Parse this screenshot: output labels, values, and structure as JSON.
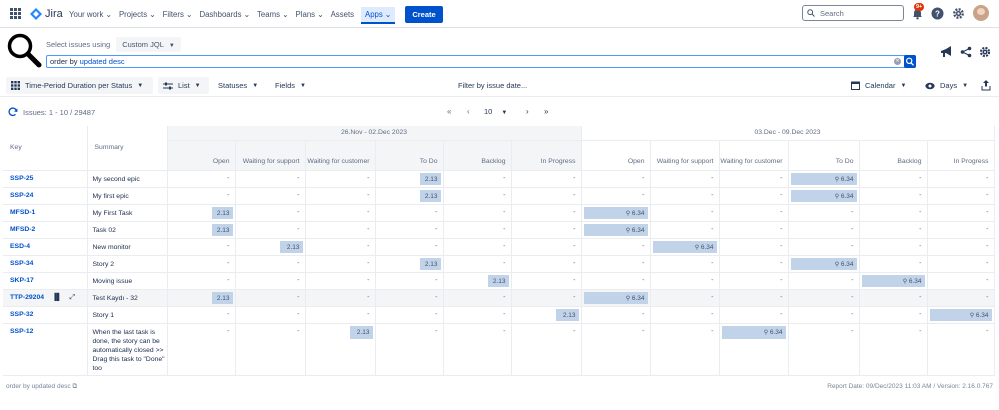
{
  "topnav": {
    "app_name": "Jira",
    "items": [
      "Your work",
      "Projects",
      "Filters",
      "Dashboards",
      "Teams",
      "Plans",
      "Assets",
      "Apps"
    ],
    "active_index": 7,
    "create_label": "Create",
    "search_placeholder": "Search",
    "notif_badge": "9+"
  },
  "filter": {
    "select_label": "Select issues using",
    "mode": "Custom JQL",
    "jql_prefix": "order by ",
    "jql_keyword": "updated desc"
  },
  "toolbar": {
    "report": "Time-Period Duration per Status",
    "list": "List",
    "statuses": "Statuses",
    "fields": "Fields",
    "filter_date": "Filter by issue date...",
    "calendar": "Calendar",
    "days": "Days"
  },
  "pager": {
    "issues": "Issues: 1 - 10 / 29487",
    "page_size": "10"
  },
  "table": {
    "key_header": "Key",
    "summary_header": "Summary",
    "groups": [
      "26.Nov - 02.Dec 2023",
      "03.Dec - 09.Dec 2023"
    ],
    "statuses": [
      "Open",
      "Waiting for support",
      "Waiting for customer",
      "To Do",
      "Backlog",
      "In Progress"
    ],
    "rows": [
      {
        "key": "SSP-25",
        "summary": "My second epic",
        "g1": [
          "-",
          "-",
          "-",
          "2.13",
          "-",
          "-"
        ],
        "g2": [
          "-",
          "-",
          "-",
          "6.34",
          "-",
          "-"
        ]
      },
      {
        "key": "SSP-24",
        "summary": "My first epic",
        "g1": [
          "-",
          "-",
          "-",
          "2.13",
          "-",
          "-"
        ],
        "g2": [
          "-",
          "-",
          "-",
          "6.34",
          "-",
          "-"
        ]
      },
      {
        "key": "MFSD-1",
        "summary": "My First Task",
        "g1": [
          "2.13",
          "-",
          "-",
          "-",
          "-",
          "-"
        ],
        "g2": [
          "6.34",
          "-",
          "-",
          "-",
          "-",
          "-"
        ]
      },
      {
        "key": "MFSD-2",
        "summary": "Task 02",
        "g1": [
          "2.13",
          "-",
          "-",
          "-",
          "-",
          "-"
        ],
        "g2": [
          "6.34",
          "-",
          "-",
          "-",
          "-",
          "-"
        ]
      },
      {
        "key": "ESD-4",
        "summary": "New monitor",
        "g1": [
          "-",
          "2.13",
          "-",
          "-",
          "-",
          "-"
        ],
        "g2": [
          "-",
          "6.34",
          "-",
          "-",
          "-",
          "-"
        ]
      },
      {
        "key": "SSP-34",
        "summary": "Story 2",
        "g1": [
          "-",
          "-",
          "-",
          "2.13",
          "-",
          "-"
        ],
        "g2": [
          "-",
          "-",
          "-",
          "6.34",
          "-",
          "-"
        ]
      },
      {
        "key": "SKP-17",
        "summary": "Moving issue",
        "g1": [
          "-",
          "-",
          "-",
          "-",
          "2.13",
          "-"
        ],
        "g2": [
          "-",
          "-",
          "-",
          "-",
          "6.34",
          "-"
        ]
      },
      {
        "key": "TTP-29204",
        "summary": "Test Kaydı - 32",
        "g1": [
          "2.13",
          "-",
          "-",
          "-",
          "-",
          "-"
        ],
        "g2": [
          "6.34",
          "-",
          "-",
          "-",
          "-",
          "-"
        ],
        "highlight": true
      },
      {
        "key": "SSP-32",
        "summary": "Story 1",
        "g1": [
          "-",
          "-",
          "-",
          "-",
          "-",
          "2.13"
        ],
        "g2": [
          "-",
          "-",
          "-",
          "-",
          "-",
          "6.34"
        ]
      },
      {
        "key": "SSP-12",
        "summary": "When the last task is done, the story can be automatically closed >> Drag this task to \"Done\" too",
        "g1": [
          "-",
          "-",
          "2.13",
          "-",
          "-",
          "-"
        ],
        "g2": [
          "-",
          "-",
          "6.34",
          "-",
          "-",
          "-"
        ]
      }
    ]
  },
  "footer": {
    "jql": "order by updated desc",
    "report_info": "Report Date: 09/Dec/2023 11:03 AM / Version: 2.16.0.767"
  }
}
